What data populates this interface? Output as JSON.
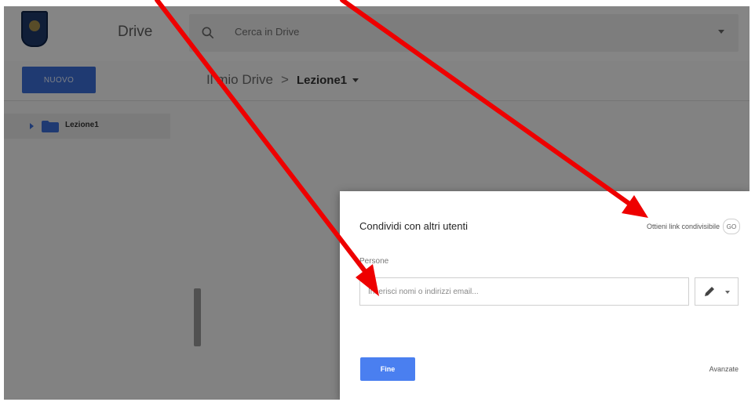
{
  "header": {
    "app_title": "Drive",
    "search_placeholder": "Cerca in Drive"
  },
  "toolbar": {
    "new_label": "NUOVO",
    "breadcrumb_root": "Il mio Drive",
    "breadcrumb_separator": ">",
    "breadcrumb_current": "Lezione1"
  },
  "sidebar": {
    "items": [
      {
        "label": "Lezione1"
      }
    ]
  },
  "dialog": {
    "title": "Condividi con altri utenti",
    "share_link_label": "Ottieni link condivisibile",
    "link_icon_text": "GO",
    "people_label": "Persone",
    "people_placeholder": "Inserisci nomi o indirizzi email...",
    "done_label": "Fine",
    "advanced_label": "Avanzate"
  },
  "colors": {
    "accent_blue": "#4a7ff0",
    "annotation_red": "#ee0000"
  }
}
